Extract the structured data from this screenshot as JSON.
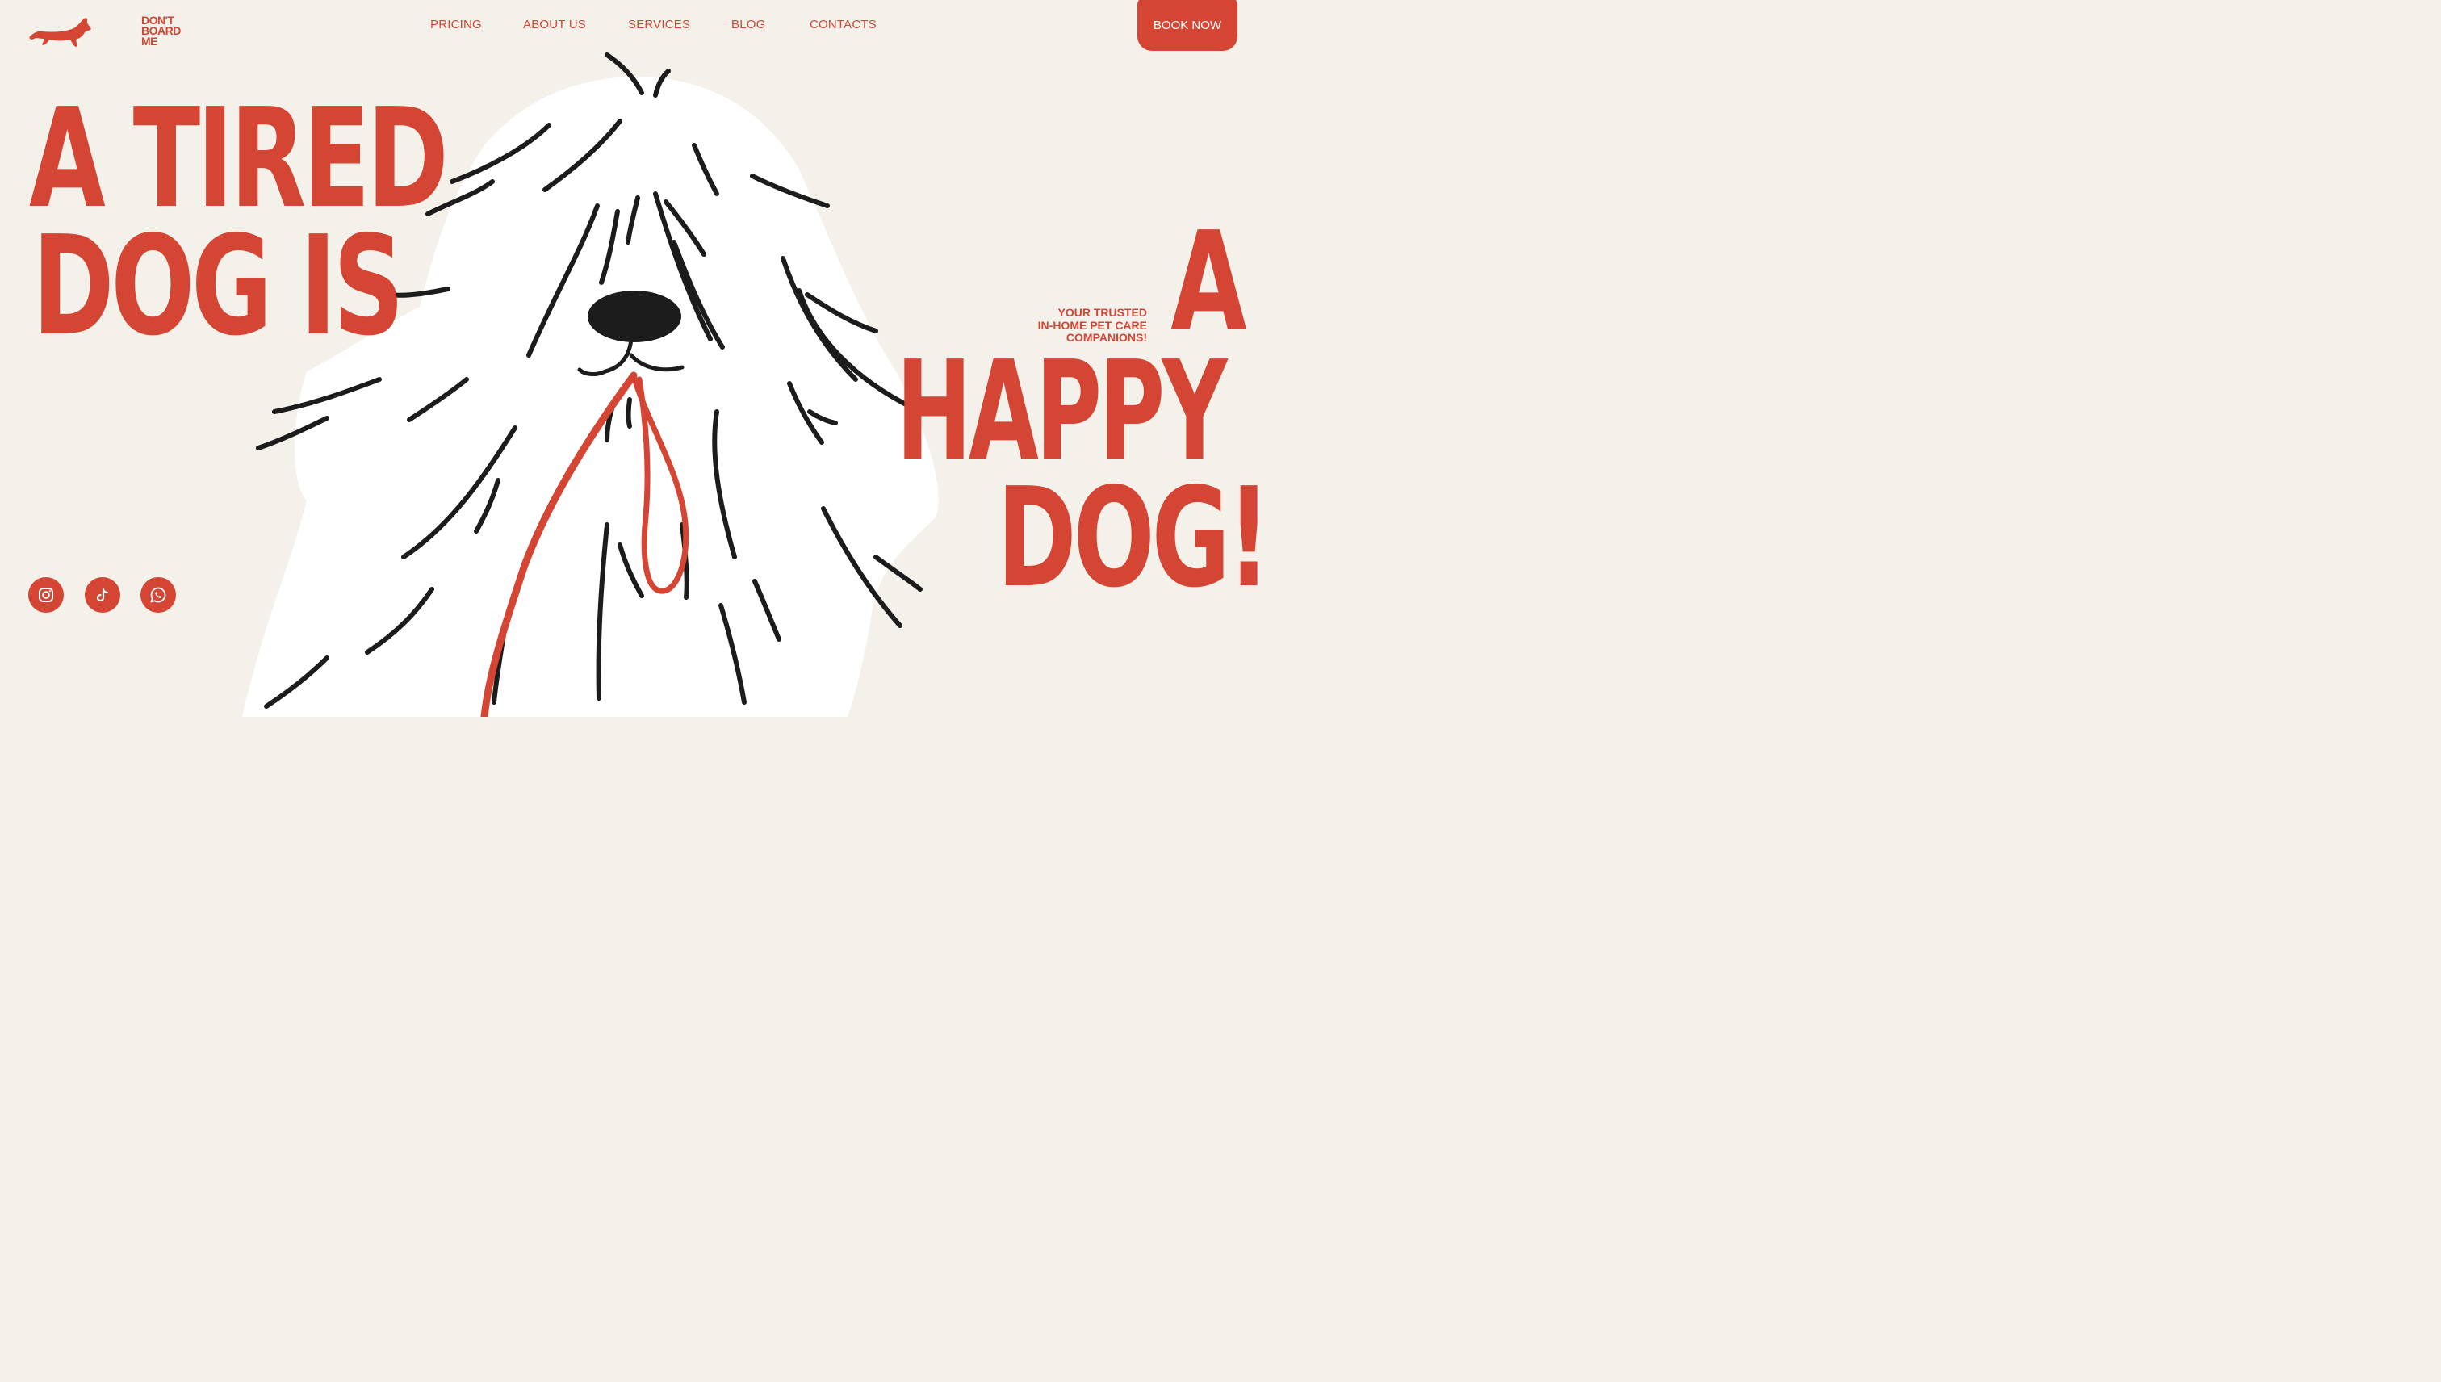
{
  "brand": {
    "logo_lines": [
      "DON'T",
      "BOARD",
      "ME"
    ],
    "mascot_icon": "dachshund-icon",
    "accent_color": "#d44534",
    "background_color": "#f3f1ea"
  },
  "nav": {
    "items": [
      {
        "label": "PRICING"
      },
      {
        "label": "ABOUT US"
      },
      {
        "label": "SERVICES"
      },
      {
        "label": "BLOG"
      },
      {
        "label": "CONTACTS"
      }
    ],
    "cta_label": "BOOK NOW"
  },
  "hero": {
    "headline_left": [
      "A TIRED",
      "DOG IS"
    ],
    "headline_right": [
      "A",
      "HAPPY",
      "DOG!"
    ],
    "tagline": [
      "YOUR TRUSTED",
      "IN-HOME PET CARE",
      "COMPANIONS!"
    ]
  },
  "social": [
    {
      "icon": "instagram-icon"
    },
    {
      "icon": "tiktok-icon"
    },
    {
      "icon": "whatsapp-icon"
    }
  ]
}
